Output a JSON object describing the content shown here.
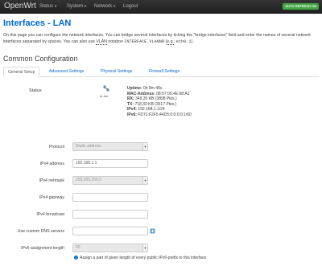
{
  "navbar": {
    "brand": "OpenWrt",
    "items": [
      {
        "label": "Status"
      },
      {
        "label": "System"
      },
      {
        "label": "Network"
      },
      {
        "label": "Logout"
      }
    ],
    "auto_refresh": "AUTO REFRESH ON"
  },
  "page": {
    "title": "Interfaces - LAN",
    "desc_part1": "On this page you can configure the network interfaces. You can bridge several interfaces by ticking the \"bridge interfaces\" field and enter the names of several network interfaces separated by spaces. You can also use ",
    "desc_vlan": "VLAN",
    "desc_part2": " notation ",
    "desc_code1": "INTERFACE.VLANNR",
    "desc_open": " (",
    "desc_eg": "e.g.",
    "desc_mid": ": ",
    "desc_code2": "eth0.1",
    "desc_end": ")."
  },
  "section": {
    "title": "Common Configuration",
    "tabs": [
      {
        "label": "General Setup",
        "active": true
      },
      {
        "label": "Advanced Settings",
        "active": false
      },
      {
        "label": "Physical Settings",
        "active": false
      },
      {
        "label": "Firewall Settings",
        "active": false
      }
    ]
  },
  "status": {
    "label": "Status",
    "icon": "bridge-icon",
    "iface_name": "br-lan",
    "uptime_label": "Uptime:",
    "uptime": "0h 8m 48s",
    "mac_label": "MAC-Address:",
    "mac": "08:57:00:4E:68:A2",
    "rx_label": "RX:",
    "rx": "349.35 KB (3898 Pkts.)",
    "tx_label": "TX:",
    "tx": "718.30 KB (3517 Pkts.)",
    "ipv4_label": "IPv4:",
    "ipv4": "192.168.1.1/24",
    "ipv6_label": "IPv6:",
    "ipv6": "FD71:F2F5:44D5:0:0:0:0:1/60"
  },
  "form": {
    "protocol": {
      "label": "Protocol",
      "value": "Static address"
    },
    "ipv4_address": {
      "label": "IPv4 address",
      "value": "192.168.1.1"
    },
    "ipv4_netmask": {
      "label": "IPv4 netmask",
      "value": "255.255.255.0"
    },
    "ipv4_gateway": {
      "label": "IPv4 gateway",
      "value": ""
    },
    "ipv4_broadcast": {
      "label": "IPv4 broadcast",
      "value": ""
    },
    "dns": {
      "label": "Use custom DNS servers",
      "value": ""
    },
    "ipv6_len": {
      "label": "IPv6 assignment length",
      "value": "60"
    },
    "ipv6_hint": "Assign a part of given length of every public IPv6-prefix to this interface",
    "hint_icon": "info-icon"
  },
  "colors": {
    "accent": "#0069d6",
    "navbar": "#222222",
    "refresh": "#46a546"
  }
}
